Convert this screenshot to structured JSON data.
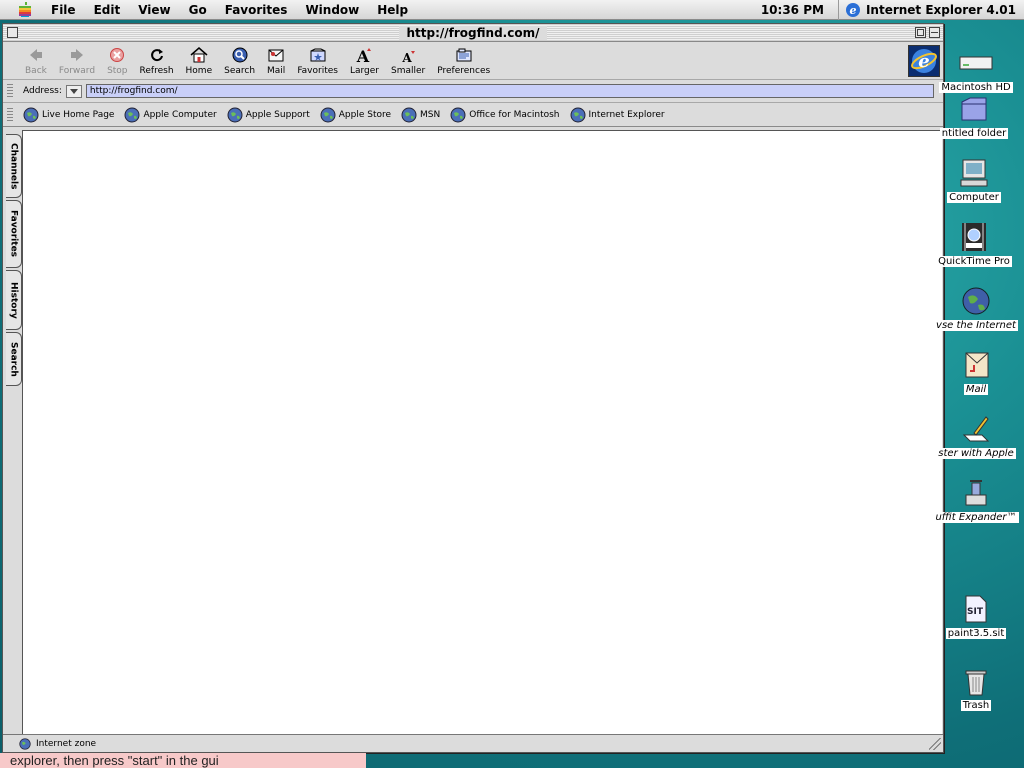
{
  "menubar": {
    "items": [
      "File",
      "Edit",
      "View",
      "Go",
      "Favorites",
      "Window",
      "Help"
    ],
    "clock": "10:36 PM",
    "app_name": "Internet Explorer 4.01"
  },
  "window": {
    "title": "http://frogfind.com/"
  },
  "toolbar": {
    "buttons": [
      {
        "label": "Back",
        "icon": "back-arrow-icon",
        "enabled": false
      },
      {
        "label": "Forward",
        "icon": "forward-arrow-icon",
        "enabled": false
      },
      {
        "label": "Stop",
        "icon": "stop-icon",
        "enabled": false
      },
      {
        "label": "Refresh",
        "icon": "refresh-icon",
        "enabled": true
      },
      {
        "label": "Home",
        "icon": "home-icon",
        "enabled": true
      },
      {
        "label": "Search",
        "icon": "search-icon",
        "enabled": true
      },
      {
        "label": "Mail",
        "icon": "mail-icon",
        "enabled": true
      },
      {
        "label": "Favorites",
        "icon": "favorites-icon",
        "enabled": true
      },
      {
        "label": "Larger",
        "icon": "larger-text-icon",
        "enabled": true
      },
      {
        "label": "Smaller",
        "icon": "smaller-text-icon",
        "enabled": true
      },
      {
        "label": "Preferences",
        "icon": "preferences-icon",
        "enabled": true
      }
    ]
  },
  "address": {
    "label": "Address:",
    "value": "http://frogfind.com/"
  },
  "favorites_bar": {
    "items": [
      "Live Home Page",
      "Apple Computer",
      "Apple Support",
      "Apple Store",
      "MSN",
      "Office for Macintosh",
      "Internet Explorer"
    ]
  },
  "side_tabs": [
    "Channels",
    "Favorites",
    "History",
    "Search"
  ],
  "status": {
    "zone": "Internet zone"
  },
  "desktop_icons": [
    {
      "label": "Macintosh HD",
      "icon": "hard-disk-icon"
    },
    {
      "label": "ntitled folder",
      "icon": "folder-icon"
    },
    {
      "label": "Computer",
      "icon": "computer-icon"
    },
    {
      "label": "QuickTime Pro",
      "icon": "quicktime-icon"
    },
    {
      "label": "vse the Internet",
      "icon": "browse-internet-icon"
    },
    {
      "label": "Mail",
      "icon": "mail-icon"
    },
    {
      "label": "ster with Apple",
      "icon": "register-icon"
    },
    {
      "label": "uffit Expander™",
      "icon": "stuffit-icon"
    },
    {
      "label": "paint3.5.sit",
      "icon": "archive-file-icon"
    },
    {
      "label": "Trash",
      "icon": "trash-icon"
    }
  ],
  "caption": {
    "text": "explorer, then press \"start\" in the gui"
  },
  "colors": {
    "address_bg": "#c9cff8",
    "desktop": "#1a8f93",
    "caption_bg": "#f7c9c9"
  }
}
